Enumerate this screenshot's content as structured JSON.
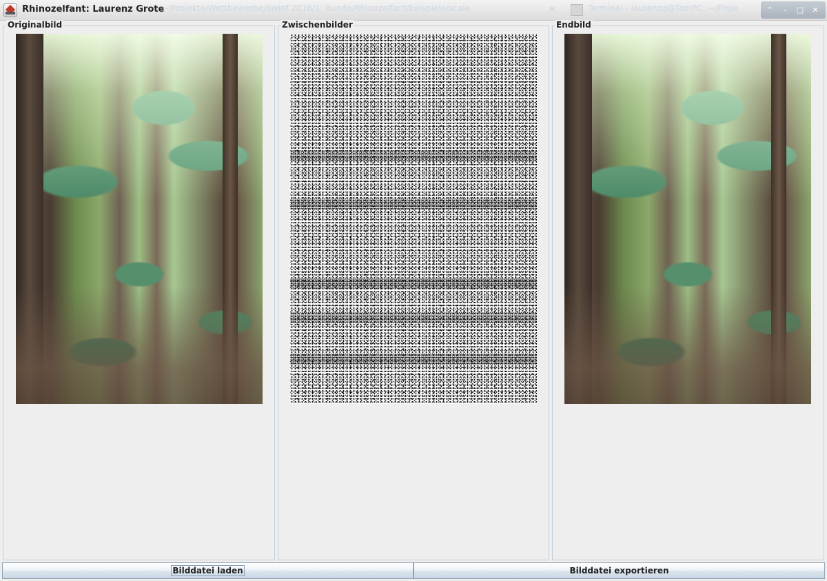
{
  "window": {
    "title": "Rhinozelfant: Laurenz Grote",
    "background_tabs": [
      "~/Projekte/Wettbewerbe/bwinf 2016/1. Runde/Rhinozelfant/beispiele/scale",
      "Terminal - laurenzg@TomPC: ~/Proje"
    ],
    "controls": {
      "maximize_glyph": "⌃",
      "minimize_glyph": "–",
      "restore_glyph": "□",
      "close_glyph": "✕"
    }
  },
  "panels": {
    "original": {
      "title": "Originalbild"
    },
    "intermediate": {
      "title": "Zwischenbilder"
    },
    "final": {
      "title": "Endbild"
    }
  },
  "buttons": {
    "load_label": "Bilddatei laden",
    "export_label": "Bilddatei exportieren"
  },
  "colors": {
    "background": "#eeeeee",
    "panel_border": "#c5cfd8",
    "button_border": "#8fa3b6"
  }
}
